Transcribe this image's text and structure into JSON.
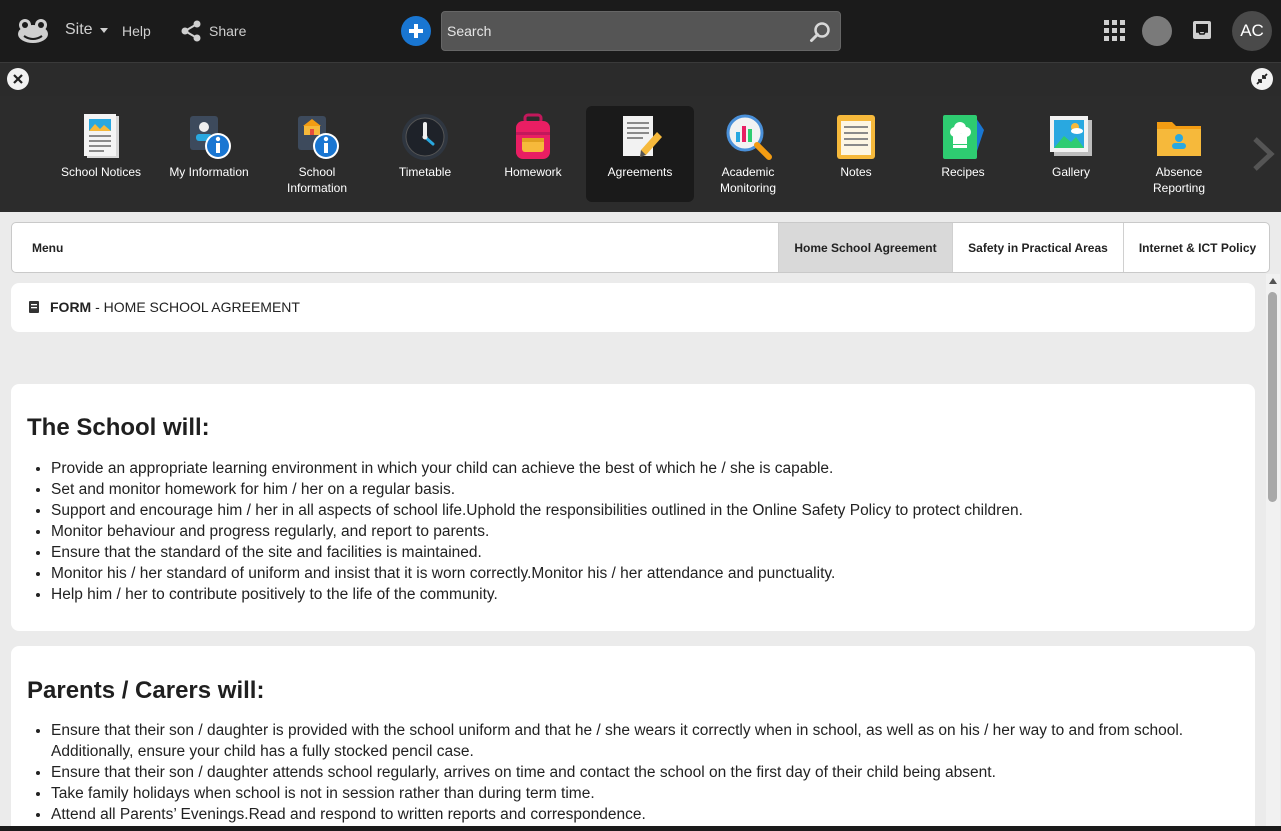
{
  "topbar": {
    "site_label": "Site",
    "help_label": "Help",
    "share_label": "Share",
    "search_placeholder": "Search",
    "avatar_initials": "AC"
  },
  "apps": [
    {
      "label": "School Notices",
      "icon": "newspaper-icon",
      "active": false
    },
    {
      "label": "My Information",
      "icon": "person-info-icon",
      "active": false
    },
    {
      "label": "School Information",
      "icon": "school-info-icon",
      "active": false
    },
    {
      "label": "Timetable",
      "icon": "clock-icon",
      "active": false
    },
    {
      "label": "Homework",
      "icon": "backpack-icon",
      "active": false
    },
    {
      "label": "Agreements",
      "icon": "document-pen-icon",
      "active": true
    },
    {
      "label": "Academic Monitoring",
      "icon": "chart-magnifier-icon",
      "active": false
    },
    {
      "label": "Notes",
      "icon": "notepad-icon",
      "active": false
    },
    {
      "label": "Recipes",
      "icon": "chef-hat-book-icon",
      "active": false
    },
    {
      "label": "Gallery",
      "icon": "picture-icon",
      "active": false
    },
    {
      "label": "Absence Reporting",
      "icon": "folder-person-icon",
      "active": false
    }
  ],
  "submenu": {
    "menu_label": "Menu",
    "tabs": [
      {
        "label": "Home School Agreement",
        "active": true
      },
      {
        "label": "Safety in Practical Areas",
        "active": false
      },
      {
        "label": "Internet & ICT Policy",
        "active": false
      }
    ]
  },
  "breadcrumb": {
    "type": "FORM",
    "separator": " - ",
    "title": "HOME SCHOOL AGREEMENT"
  },
  "sections": [
    {
      "heading": "The School will:",
      "items": [
        "Provide an appropriate learning environment in which your child can achieve the best of which he / she is capable.",
        "Set and monitor homework for him / her on a regular basis.",
        "Support and encourage him / her in all aspects of school life.Uphold the responsibilities outlined in the Online Safety Policy to protect children.",
        "Monitor behaviour and progress regularly, and report to parents.",
        "Ensure that the standard of the site and facilities is maintained.",
        "Monitor his / her standard of uniform and insist that it is worn correctly.Monitor his / her attendance and punctuality.",
        "Help him / her to contribute positively to the life of the community."
      ]
    },
    {
      "heading": "Parents / Carers will:",
      "items": [
        "Ensure that their son / daughter is provided with the school uniform and that he / she wears it correctly when in school, as well as on his / her way to and from school. Additionally, ensure your child has a fully stocked pencil case.",
        "Ensure that their son / daughter attends school regularly, arrives on time and contact the school on the first day of their child being absent.",
        "Take family holidays when school is not in session rather than during term time.",
        "Attend all Parents’ Evenings.Read and respond to written reports and correspondence."
      ]
    }
  ],
  "colors": {
    "topbar_bg": "#1b1b1b",
    "appbar_bg": "#2c2c2c",
    "accent_blue": "#1976d2",
    "page_bg": "#ebebeb"
  }
}
